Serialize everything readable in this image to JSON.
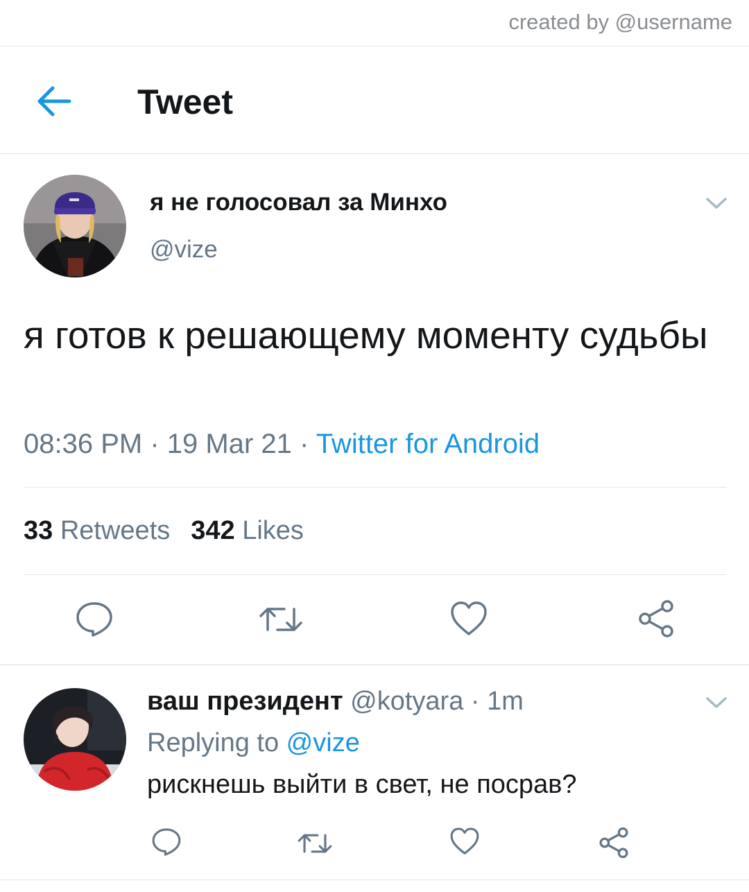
{
  "credit": "created by @username",
  "header": {
    "title": "Tweet"
  },
  "tweet": {
    "author_name": "я не голосовал за Минхо",
    "author_handle": "@vize",
    "text": "я готов к решающему моменту судьбы",
    "time": "08:36 PM",
    "sep1": " · ",
    "date": "19 Mar 21",
    "sep2": " · ",
    "source": "Twitter for Android",
    "retweets_count": "33",
    "retweets_label": "Retweets",
    "likes_count": "342",
    "likes_label": "Likes"
  },
  "reply": {
    "author_name": "ваш президент",
    "author_handle": "@kotyara",
    "sep": " · ",
    "age": "1m",
    "replying_label": "Replying to ",
    "replying_to": "@vize",
    "text": "рискнешь выйти в свет, не посрав?"
  },
  "icons": {
    "back": "arrow-left-icon",
    "more": "chevron-down-icon",
    "reply": "speech-bubble-icon",
    "retweet": "retweet-icon",
    "like": "heart-icon",
    "share": "share-icon"
  },
  "colors": {
    "accent": "#1b95e0",
    "muted": "#657786",
    "divider": "#e1e8ed",
    "text": "#14171a"
  }
}
